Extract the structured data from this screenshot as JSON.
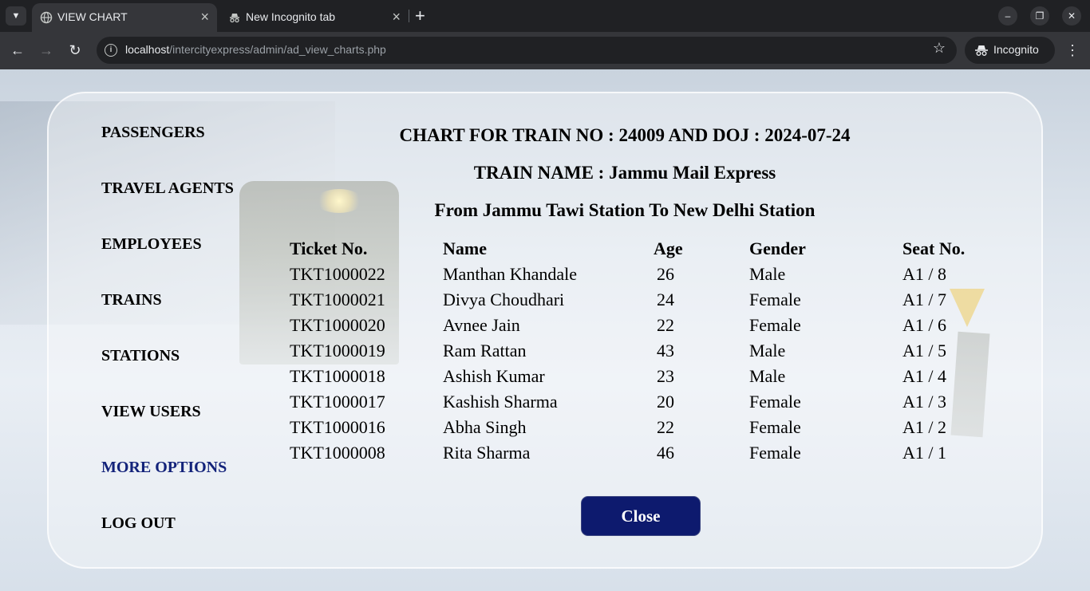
{
  "browser": {
    "tabs": [
      {
        "title": "VIEW CHART",
        "active": true
      },
      {
        "title": "New Incognito tab",
        "active": false
      }
    ],
    "url_host": "localhost",
    "url_path": "/intercityexpress/admin/ad_view_charts.php",
    "profile_label": "Incognito"
  },
  "sidebar": {
    "items": [
      {
        "label": "PASSENGERS"
      },
      {
        "label": "TRAVEL AGENTS"
      },
      {
        "label": "EMPLOYEES"
      },
      {
        "label": "TRAINS"
      },
      {
        "label": "STATIONS"
      },
      {
        "label": "VIEW USERS"
      },
      {
        "label": "MORE OPTIONS",
        "highlight_color": "#13237a"
      },
      {
        "label": "LOG OUT"
      }
    ]
  },
  "chart": {
    "heading": "CHART FOR TRAIN NO : 24009 AND DOJ : 2024-07-24",
    "train_name": "TRAIN NAME : Jammu Mail Express",
    "route": "From Jammu Tawi Station To New Delhi Station",
    "columns": [
      "Ticket No.",
      "Name",
      "Age",
      "Gender",
      "Seat No."
    ],
    "rows": [
      [
        "TKT1000022",
        "Manthan Khandale",
        "26",
        "Male",
        "A1 / 8"
      ],
      [
        "TKT1000021",
        "Divya Choudhari",
        "24",
        "Female",
        "A1 / 7"
      ],
      [
        "TKT1000020",
        "Avnee Jain",
        "22",
        "Female",
        "A1 / 6"
      ],
      [
        "TKT1000019",
        "Ram Rattan",
        "43",
        "Male",
        "A1 / 5"
      ],
      [
        "TKT1000018",
        "Ashish Kumar",
        "23",
        "Male",
        "A1 / 4"
      ],
      [
        "TKT1000017",
        "Kashish Sharma",
        "20",
        "Female",
        "A1 / 3"
      ],
      [
        "TKT1000016",
        "Abha Singh",
        "22",
        "Female",
        "A1 / 2"
      ],
      [
        "TKT1000008",
        "Rita Sharma",
        "46",
        "Female",
        "A1 / 1"
      ]
    ],
    "close_label": "Close"
  },
  "colors": {
    "close_button": "#0d1a6e",
    "browser_frame": "#202124",
    "browser_toolbar": "#35363a"
  },
  "icons": [
    "tab-search-icon",
    "globe-icon",
    "incognito-icon",
    "close-icon",
    "plus-icon",
    "minimize-icon",
    "restore-icon",
    "back-arrow-icon",
    "forward-arrow-icon",
    "reload-icon",
    "info-icon",
    "star-icon",
    "kebab-menu-icon"
  ]
}
